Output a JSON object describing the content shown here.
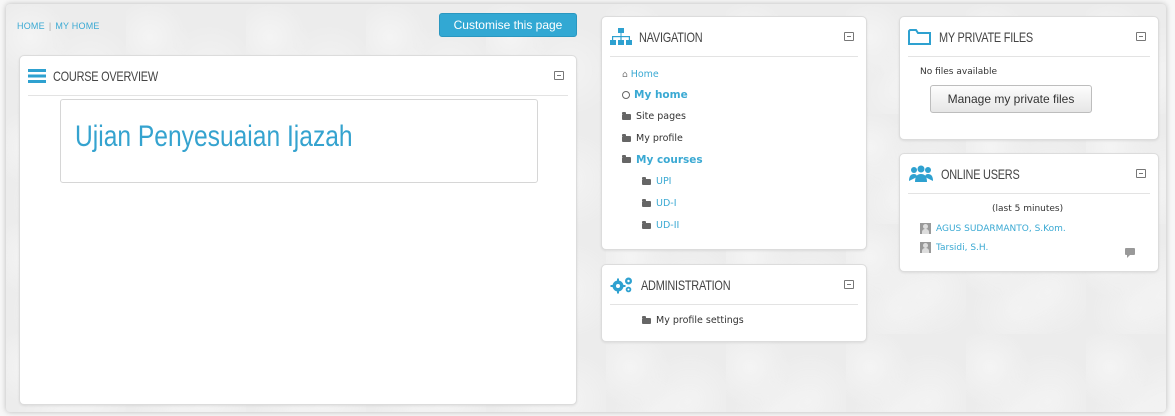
{
  "breadcrumb": {
    "items": [
      "HOME",
      "MY HOME"
    ]
  },
  "header": {
    "customise_label": "Customise this page"
  },
  "course_overview": {
    "title": "COURSE OVERVIEW",
    "course_title": "Ujian Penyesuaian Ijazah"
  },
  "navigation": {
    "title": "NAVIGATION",
    "items": [
      {
        "label": "Home",
        "icon": "home-icon"
      },
      {
        "label": "My home",
        "icon": "circle-icon"
      },
      {
        "label": "Site pages",
        "icon": "folder-icon"
      },
      {
        "label": "My profile",
        "icon": "folder-icon"
      },
      {
        "label": "My courses",
        "icon": "folder-icon"
      },
      {
        "label": "UPI",
        "icon": "folder-icon"
      },
      {
        "label": "UD-I",
        "icon": "folder-icon"
      },
      {
        "label": "UD-II",
        "icon": "folder-icon"
      }
    ]
  },
  "administration": {
    "title": "ADMINISTRATION",
    "items": [
      {
        "label": "My profile settings",
        "icon": "folder-icon"
      }
    ]
  },
  "private_files": {
    "title": "MY PRIVATE FILES",
    "empty_text": "No files available",
    "manage_label": "Manage my private files"
  },
  "online_users": {
    "title": "ONLINE USERS",
    "subtitle": "(last 5 minutes)",
    "users": [
      {
        "name": "AGUS SUDARMANTO, S.Kom."
      },
      {
        "name": "Tarsidi, S.H."
      }
    ]
  },
  "colors": {
    "accent": "#32a8d3",
    "link": "#3aa9d3"
  }
}
